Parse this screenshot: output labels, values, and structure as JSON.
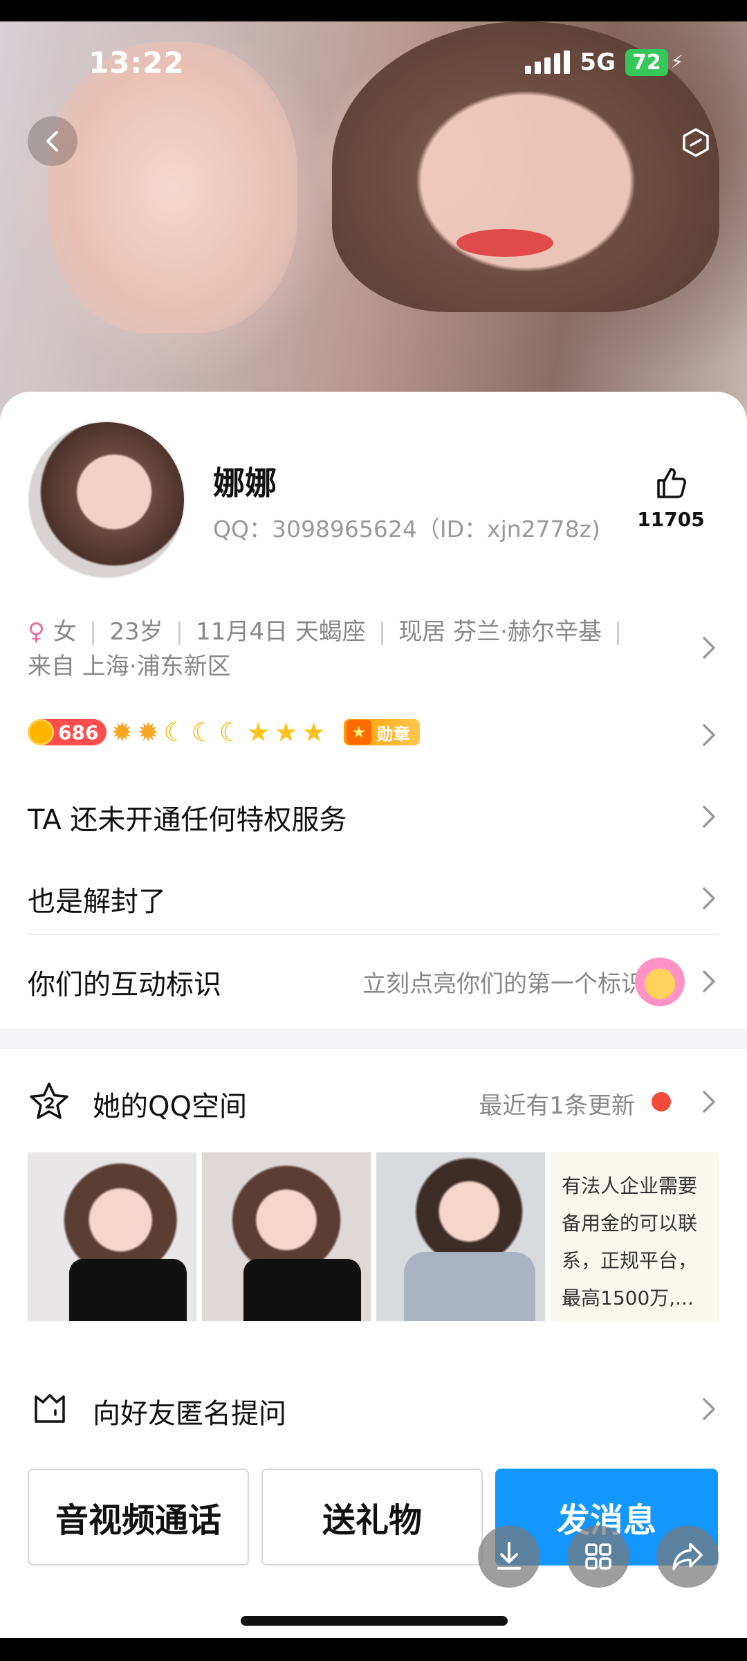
{
  "status_bar": {
    "time": "13:22",
    "network": "5G",
    "battery": "72"
  },
  "profile": {
    "name": "娜娜",
    "qq_line": "QQ：3098965624（ID：xjn2778z)",
    "likes": "11705",
    "gender": "女",
    "age": "23岁",
    "birthday": "11月4日 天蝎座",
    "residence": "现居 芬兰·赫尔辛基",
    "hometown": "来自 上海·浦东新区"
  },
  "levels": {
    "level": "686",
    "medal": "勋章"
  },
  "rows": {
    "privilege": "TA 还未开通任何特权服务",
    "signature": "也是解封了",
    "interaction_title": "你们的互动标识",
    "interaction_hint": "立刻点亮你们的第一个标识"
  },
  "qzone": {
    "title": "她的QQ空间",
    "update": "最近有1条更新",
    "text_post": "有法人企业需要备用金的可以联系，正规平台，最高1500万,..."
  },
  "ask": {
    "label": "向好友匿名提问"
  },
  "buttons": {
    "call": "音视频通话",
    "gift": "送礼物",
    "message": "发消息"
  },
  "colors": {
    "primary": "#1296ff",
    "badge_red": "#ff4d4d",
    "dot_red": "#f34a3a"
  }
}
